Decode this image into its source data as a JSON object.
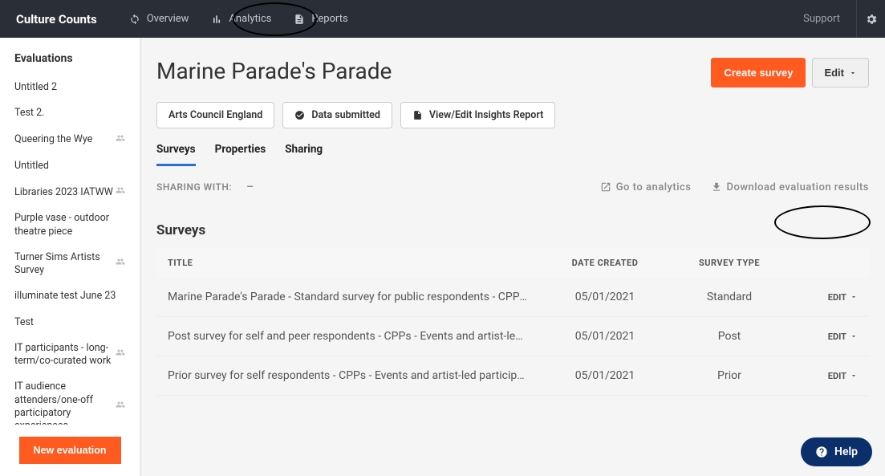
{
  "brand": "Culture Counts",
  "nav": {
    "overview": "Overview",
    "analytics": "Analytics",
    "reports": "Reports",
    "support": "Support"
  },
  "sidebar": {
    "header": "Evaluations",
    "items": [
      {
        "label": "Untitled 2",
        "shared": false
      },
      {
        "label": "Test 2.",
        "shared": false
      },
      {
        "label": "Queering the Wye",
        "shared": true
      },
      {
        "label": "Untitled",
        "shared": false
      },
      {
        "label": "Libraries 2023 IATWW",
        "shared": true
      },
      {
        "label": "Purple vase - outdoor theatre piece",
        "shared": false
      },
      {
        "label": "Turner Sims Artists Survey",
        "shared": true
      },
      {
        "label": "illuminate test June 23",
        "shared": false
      },
      {
        "label": "Test",
        "shared": false
      },
      {
        "label": "IT participants - long-term/co-curated work",
        "shared": true
      },
      {
        "label": "IT audience attenders/one-off participatory experiences",
        "shared": true
      }
    ],
    "new_button": "New evaluation"
  },
  "page": {
    "title": "Marine Parade's Parade",
    "create_survey": "Create survey",
    "edit": "Edit"
  },
  "chips": {
    "org": "Arts Council England",
    "data_submitted": "Data submitted",
    "insights": "View/Edit Insights Report"
  },
  "tabs": {
    "surveys": "Surveys",
    "properties": "Properties",
    "sharing": "Sharing"
  },
  "sharing": {
    "label": "SHARING WITH:",
    "value": "–",
    "go_analytics": "Go to analytics",
    "download": "Download evaluation results"
  },
  "surveys_section": {
    "heading": "Surveys",
    "columns": {
      "title": "TITLE",
      "date": "DATE CREATED",
      "type": "SURVEY TYPE"
    },
    "edit_label": "EDIT",
    "rows": [
      {
        "title": "Marine Parade's Parade - Standard survey for public respondents - CPPs - Eve…",
        "date": "05/01/2021",
        "type": "Standard"
      },
      {
        "title": "Post survey for self and peer respondents - CPPs - Events and artist-led partic…",
        "date": "05/01/2021",
        "type": "Post"
      },
      {
        "title": "Prior survey for self respondents - CPPs - Events and artist-led participatory",
        "date": "05/01/2021",
        "type": "Prior"
      }
    ]
  },
  "help": "Help"
}
